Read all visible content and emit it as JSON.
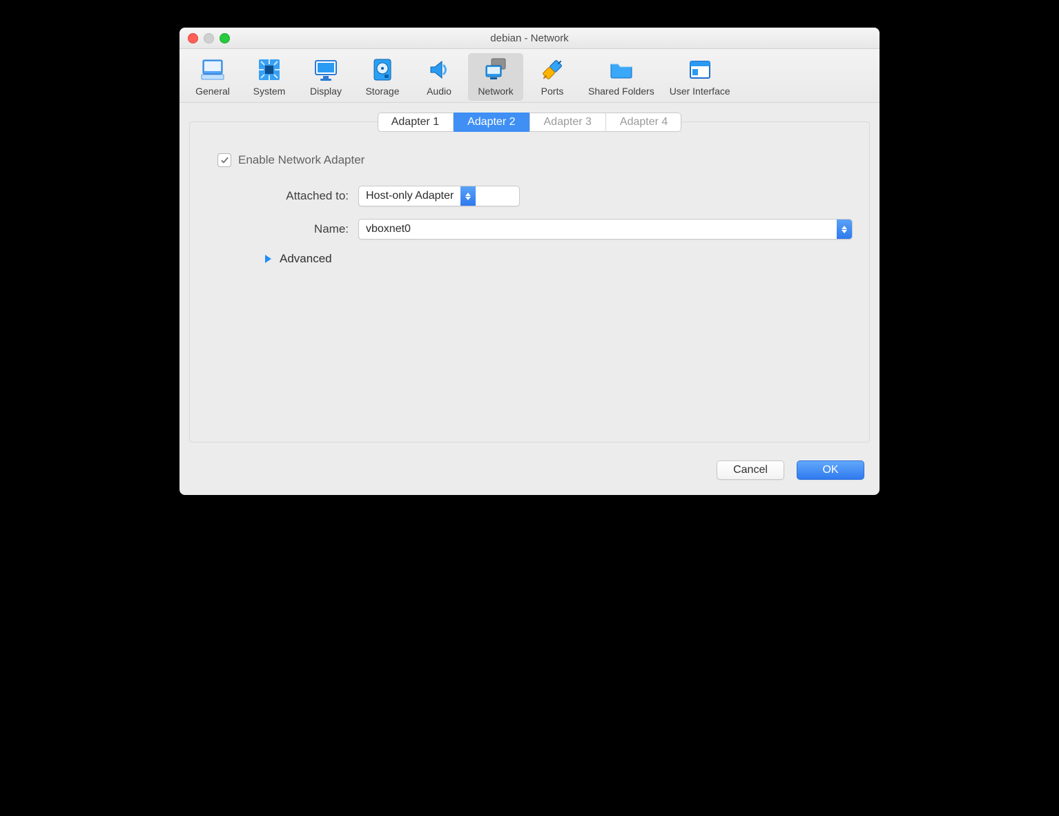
{
  "window": {
    "title": "debian - Network"
  },
  "toolbar": {
    "items": [
      {
        "label": "General"
      },
      {
        "label": "System"
      },
      {
        "label": "Display"
      },
      {
        "label": "Storage"
      },
      {
        "label": "Audio"
      },
      {
        "label": "Network"
      },
      {
        "label": "Ports"
      },
      {
        "label": "Shared Folders"
      },
      {
        "label": "User Interface"
      }
    ],
    "selected": "Network"
  },
  "tabs": {
    "items": [
      "Adapter 1",
      "Adapter 2",
      "Adapter 3",
      "Adapter 4"
    ],
    "active": "Adapter 2",
    "enabled": [
      "Adapter 1",
      "Adapter 2"
    ]
  },
  "form": {
    "enable_label": "Enable Network Adapter",
    "enable_checked": true,
    "attached_label": "Attached to:",
    "attached_value": "Host-only Adapter",
    "name_label": "Name:",
    "name_value": "vboxnet0",
    "advanced_label": "Advanced"
  },
  "footer": {
    "cancel": "Cancel",
    "ok": "OK"
  }
}
